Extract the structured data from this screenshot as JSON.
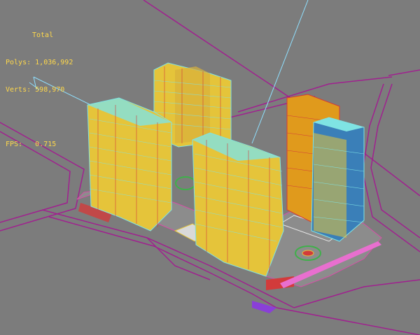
{
  "viewport": {
    "name": "3d-wireframe-viewport",
    "background": "#7c7c7c"
  },
  "stats": {
    "header": "Total",
    "polys_label": "Polys:",
    "polys_value": "1,036,992",
    "verts_label": "Verts:",
    "verts_value": "598,970",
    "fps_label": "FPS:",
    "fps_value": "0.715",
    "color": "#ffd84a"
  },
  "palette": {
    "road_lines": "#a0218f",
    "light_ray": "#8fe0ff",
    "building_warm": "#e5c43a",
    "building_cyan": "#7fe3e3",
    "building_orange": "#e09a1c",
    "building_blue": "#3a7fb8",
    "accent_red": "#d23b3b",
    "plaza_green": "#3fb04a"
  }
}
